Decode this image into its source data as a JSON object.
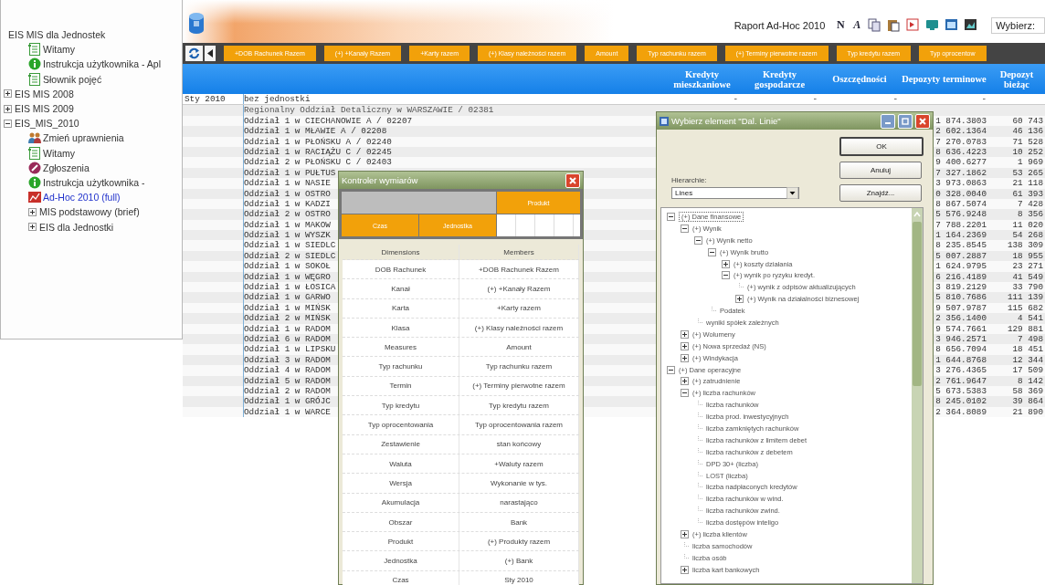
{
  "sidebar": {
    "items": [
      {
        "label": "EIS MIS dla Jednostek",
        "kind": "root",
        "selected": false,
        "children": [
          {
            "label": "Witamy",
            "kind": "page",
            "selected": false
          },
          {
            "label": "Instrukcja użytkownika - Apl",
            "kind": "info",
            "selected": false
          },
          {
            "label": "Słownik pojęć",
            "kind": "page",
            "selected": false
          }
        ]
      },
      {
        "label": "EIS MIS 2008",
        "kind": "folder",
        "expanded": false,
        "selected": false
      },
      {
        "label": "EIS MIS 2009",
        "kind": "folder",
        "expanded": false,
        "selected": false
      },
      {
        "label": "EIS_MIS_2010",
        "kind": "folder",
        "expanded": true,
        "selected": false,
        "children": [
          {
            "label": "Zmień uprawnienia",
            "kind": "users",
            "selected": false
          },
          {
            "label": "Witamy",
            "kind": "page",
            "selected": false
          },
          {
            "label": "Zgłoszenia",
            "kind": "alert",
            "selected": false
          },
          {
            "label": "Instrukcja użytkownika -",
            "kind": "info",
            "selected": false
          },
          {
            "label": "Ad-Hoc 2010 (full)",
            "kind": "report",
            "selected": true
          },
          {
            "label": "MIS podstawowy (brief)",
            "kind": "folder",
            "expanded": false,
            "selected": false
          },
          {
            "label": "EIS dla Jednostki",
            "kind": "folder",
            "expanded": false,
            "selected": false
          }
        ]
      }
    ]
  },
  "header": {
    "title": "Raport Ad-Hoc 2010",
    "format_buttons": [
      "N",
      "A"
    ],
    "selector": "Wybierz:"
  },
  "toolbar": {
    "buttons": [
      "+DOB Rachunek Razem",
      "(+) +Kanały Razem",
      "+Karty razem",
      "(+) Klasy należności razem",
      "Amount",
      "Typ rachunku razem",
      "(+) Terminy pierwotne razem",
      "Typ kredytu razem",
      "Typ oprocentow"
    ]
  },
  "table": {
    "columns": [
      "Kredyty mieszkaniowe",
      "Kredyty gospodarcze",
      "Oszczędności",
      "Depozyty terminowe",
      "Depozyt bieżąc"
    ],
    "rows": [
      {
        "kind": "period",
        "period": "Sty 2010",
        "unit": "bez jednostki",
        "values": [
          "-",
          "-",
          "-",
          "-"
        ]
      },
      {
        "kind": "region",
        "unit": "Regionalny Oddział Detaliczny w WARSZAWIE / 02381"
      },
      {
        "kind": "unit",
        "unit": "Oddział 1 w CIECHANOWIE A / 02207",
        "term": "1 874.3803",
        "current": "60 743"
      },
      {
        "kind": "unit",
        "unit": "Oddział 1 w MŁAWIE A / 02208",
        "term": "2 602.1364",
        "current": "46 136"
      },
      {
        "kind": "unit",
        "unit": "Oddział 1 w PŁOŃSKU A / 02240",
        "term": "7 270.0783",
        "current": "71 528"
      },
      {
        "kind": "unit",
        "unit": "Oddział 1 w RACIĄŻU C / 02245",
        "term": "8 636.4223",
        "current": "10 252"
      },
      {
        "kind": "unit",
        "unit": "Oddział 2 w PŁOŃSKU C / 02403",
        "term": "9 400.6277",
        "current": "1 969"
      },
      {
        "kind": "unit",
        "unit": "Oddział 1 w PUŁTUS",
        "term": "7 327.1862",
        "current": "53 265"
      },
      {
        "kind": "unit",
        "unit": "Oddział 1 w NASIE",
        "term": "3 973.0863",
        "current": "21 118"
      },
      {
        "kind": "unit",
        "unit": "Oddział 1 w OSTRO",
        "term": "0 328.0040",
        "current": "61 393"
      },
      {
        "kind": "unit",
        "unit": "Oddział 1 w KADZI",
        "term": "8 867.5074",
        "current": "7 428"
      },
      {
        "kind": "unit",
        "unit": "Oddział 2 w OSTRO",
        "term": "5 576.9248",
        "current": "8 356"
      },
      {
        "kind": "unit",
        "unit": "Oddział 1 w MAKOW",
        "term": "7 788.2201",
        "current": "11 020"
      },
      {
        "kind": "unit",
        "unit": "Oddział 1 w WYSZK",
        "term": "1 164.2369",
        "current": "54 268"
      },
      {
        "kind": "unit",
        "unit": "Oddział 1 w SIEDLC",
        "term": "8 235.8545",
        "current": "138 309"
      },
      {
        "kind": "unit",
        "unit": "Oddział 2 w SIEDLC",
        "term": "5 007.2887",
        "current": "18 955"
      },
      {
        "kind": "unit",
        "unit": "Oddział 1 w SOKOŁ",
        "term": "1 624.9795",
        "current": "23 271"
      },
      {
        "kind": "unit",
        "unit": "Oddział 1 w WĘGRO",
        "term": "6 216.4189",
        "current": "41 549"
      },
      {
        "kind": "unit",
        "unit": "Oddział 1 w ŁOSICA",
        "term": "3 819.2129",
        "current": "33 790"
      },
      {
        "kind": "unit",
        "unit": "Oddział 1 w GARWO",
        "term": "5 810.7686",
        "current": "111 139"
      },
      {
        "kind": "unit",
        "unit": "Oddział 1 w MIŃSK",
        "term": "9 507.9787",
        "current": "115 682"
      },
      {
        "kind": "unit",
        "unit": "Oddział 2 w MIŃSK",
        "term": "2 356.1400",
        "current": "4 541"
      },
      {
        "kind": "unit",
        "unit": "Oddział 1 w RADOM",
        "term": "9 574.7661",
        "current": "129 881"
      },
      {
        "kind": "unit",
        "unit": "Oddział 6 w RADOM",
        "term": "3 946.2571",
        "current": "7 498"
      },
      {
        "kind": "unit",
        "unit": "Oddział 1 w LIPSKU",
        "term": "8 656.7094",
        "current": "18 451"
      },
      {
        "kind": "unit",
        "unit": "Oddział 3 w RADOM",
        "term": "1 644.8768",
        "current": "12 344"
      },
      {
        "kind": "unit",
        "unit": "Oddział 4 w RADOM",
        "term": "3 276.4365",
        "current": "17 509"
      },
      {
        "kind": "unit",
        "unit": "Oddział 5 w RADOM",
        "term": "2 761.9647",
        "current": "8 142"
      },
      {
        "kind": "unit",
        "unit": "Oddział 2 w RADOM",
        "term": "5 673.5383",
        "current": "58 369"
      },
      {
        "kind": "unit",
        "unit": "Oddział 1 w GRÓJC",
        "term": "8 245.0102",
        "current": "39 864"
      },
      {
        "kind": "unit",
        "unit": "Oddział 1 w WARCE",
        "term": "2 364.8089",
        "current": "21 890"
      }
    ]
  },
  "controller": {
    "title": "Kontroler wymiarów",
    "pivot": {
      "columns": [
        "Produkt"
      ],
      "rows": [
        "Czas",
        "Jednostka"
      ]
    },
    "headers": [
      "Dimensions",
      "Members"
    ],
    "rows": [
      [
        "DOB Rachunek",
        "+DOB Rachunek Razem"
      ],
      [
        "Kanał",
        "(+) +Kanały Razem"
      ],
      [
        "Karta",
        "+Karty razem"
      ],
      [
        "Klasa",
        "(+) Klasy należności razem"
      ],
      [
        "Measures",
        "Amount"
      ],
      [
        "Typ rachunku",
        "Typ rachunku razem"
      ],
      [
        "Termin",
        "(+) Terminy pierwotne razem"
      ],
      [
        "Typ kredytu",
        "Typ kredytu razem"
      ],
      [
        "Typ oprocentowania",
        "Typ oprocentowania razem"
      ],
      [
        "Zestawienie",
        "stan końcowy"
      ],
      [
        "Waluta",
        "+Waluty razem"
      ],
      [
        "Wersja",
        "Wykonanie w tys."
      ],
      [
        "Akumulacja",
        "narastająco"
      ],
      [
        "Obszar",
        "Bank"
      ],
      [
        "Produkt",
        "(+) Produkty razem"
      ],
      [
        "Jednostka",
        "(+) Bank"
      ],
      [
        "Czas",
        "Sty 2010"
      ]
    ]
  },
  "picker": {
    "title": "Wybierz element \"Dal. Linie\"",
    "buttons": [
      "OK",
      "Anuluj",
      "Znajdź..."
    ],
    "hierarchy_label": "Hierarchie:",
    "hierarchy": "Lines",
    "tree": [
      {
        "label": "(+) Dane finansowe",
        "kind": "branch",
        "expanded": true,
        "selected": true,
        "children": [
          {
            "label": "(+) Wynik",
            "kind": "branch",
            "expanded": true,
            "selected": false,
            "children": [
              {
                "label": "(+) Wynik netto",
                "kind": "branch",
                "expanded": true,
                "selected": false,
                "children": [
                  {
                    "label": "(+) Wynik brutto",
                    "kind": "branch",
                    "expanded": true,
                    "selected": false,
                    "children": [
                      {
                        "label": "(+) koszty działania",
                        "kind": "branch",
                        "expanded": false,
                        "selected": false
                      },
                      {
                        "label": "(+) wynik po ryzyku kredyt.",
                        "kind": "branch",
                        "expanded": true,
                        "selected": false,
                        "children": [
                          {
                            "label": "(+) wynik z odpisów aktualizujących",
                            "kind": "leaf",
                            "selected": false
                          },
                          {
                            "label": "(+) Wynik na działalności biznesowej",
                            "kind": "branch",
                            "expanded": false,
                            "selected": false
                          }
                        ]
                      }
                    ]
                  },
                  {
                    "label": "Podatek",
                    "kind": "leaf",
                    "selected": false
                  }
                ]
              },
              {
                "label": "wyniki spółek zależnych",
                "kind": "leaf",
                "selected": false
              }
            ]
          },
          {
            "label": "(+) Wolumeny",
            "kind": "branch",
            "expanded": false,
            "selected": false
          },
          {
            "label": "(+) Nowa sprzedaż (NS)",
            "kind": "branch",
            "expanded": false,
            "selected": false
          },
          {
            "label": "(+) Windykacja",
            "kind": "branch",
            "expanded": false,
            "selected": false
          }
        ]
      },
      {
        "label": "(+) Dane operacyjne",
        "kind": "branch",
        "expanded": true,
        "selected": false,
        "children": [
          {
            "label": "(+) zatrudnienie",
            "kind": "branch",
            "expanded": false,
            "selected": false
          },
          {
            "label": "(+) liczba rachunków",
            "kind": "branch",
            "expanded": true,
            "selected": false,
            "children": [
              {
                "label": "liczba rachunków",
                "kind": "leaf",
                "selected": false
              },
              {
                "label": "liczba prod. inwestycyjnych",
                "kind": "leaf",
                "selected": false
              },
              {
                "label": "liczba zamkniętych rachunków",
                "kind": "leaf",
                "selected": false
              },
              {
                "label": "liczba rachunków z limitem debet",
                "kind": "leaf",
                "selected": false
              },
              {
                "label": "liczba rachunków z debetem",
                "kind": "leaf",
                "selected": false
              },
              {
                "label": "DPD 30+ (liczba)",
                "kind": "leaf",
                "selected": false
              },
              {
                "label": "LOST (liczba)",
                "kind": "leaf",
                "selected": false
              },
              {
                "label": "liczba nadpłaconych kredytów",
                "kind": "leaf",
                "selected": false
              },
              {
                "label": "liczba rachunków w wind.",
                "kind": "leaf",
                "selected": false
              },
              {
                "label": "liczba rachunków zwind.",
                "kind": "leaf",
                "selected": false
              },
              {
                "label": "liczba dostępów inteligo",
                "kind": "leaf",
                "selected": false
              }
            ]
          },
          {
            "label": "(+) liczba klientów",
            "kind": "branch",
            "expanded": false,
            "selected": false
          },
          {
            "label": "liczba samochodów",
            "kind": "leaf",
            "selected": false
          },
          {
            "label": "liczba osób",
            "kind": "leaf",
            "selected": false
          },
          {
            "label": "liczba kart bankowych",
            "kind": "branch",
            "expanded": false,
            "selected": false
          }
        ]
      }
    ]
  }
}
